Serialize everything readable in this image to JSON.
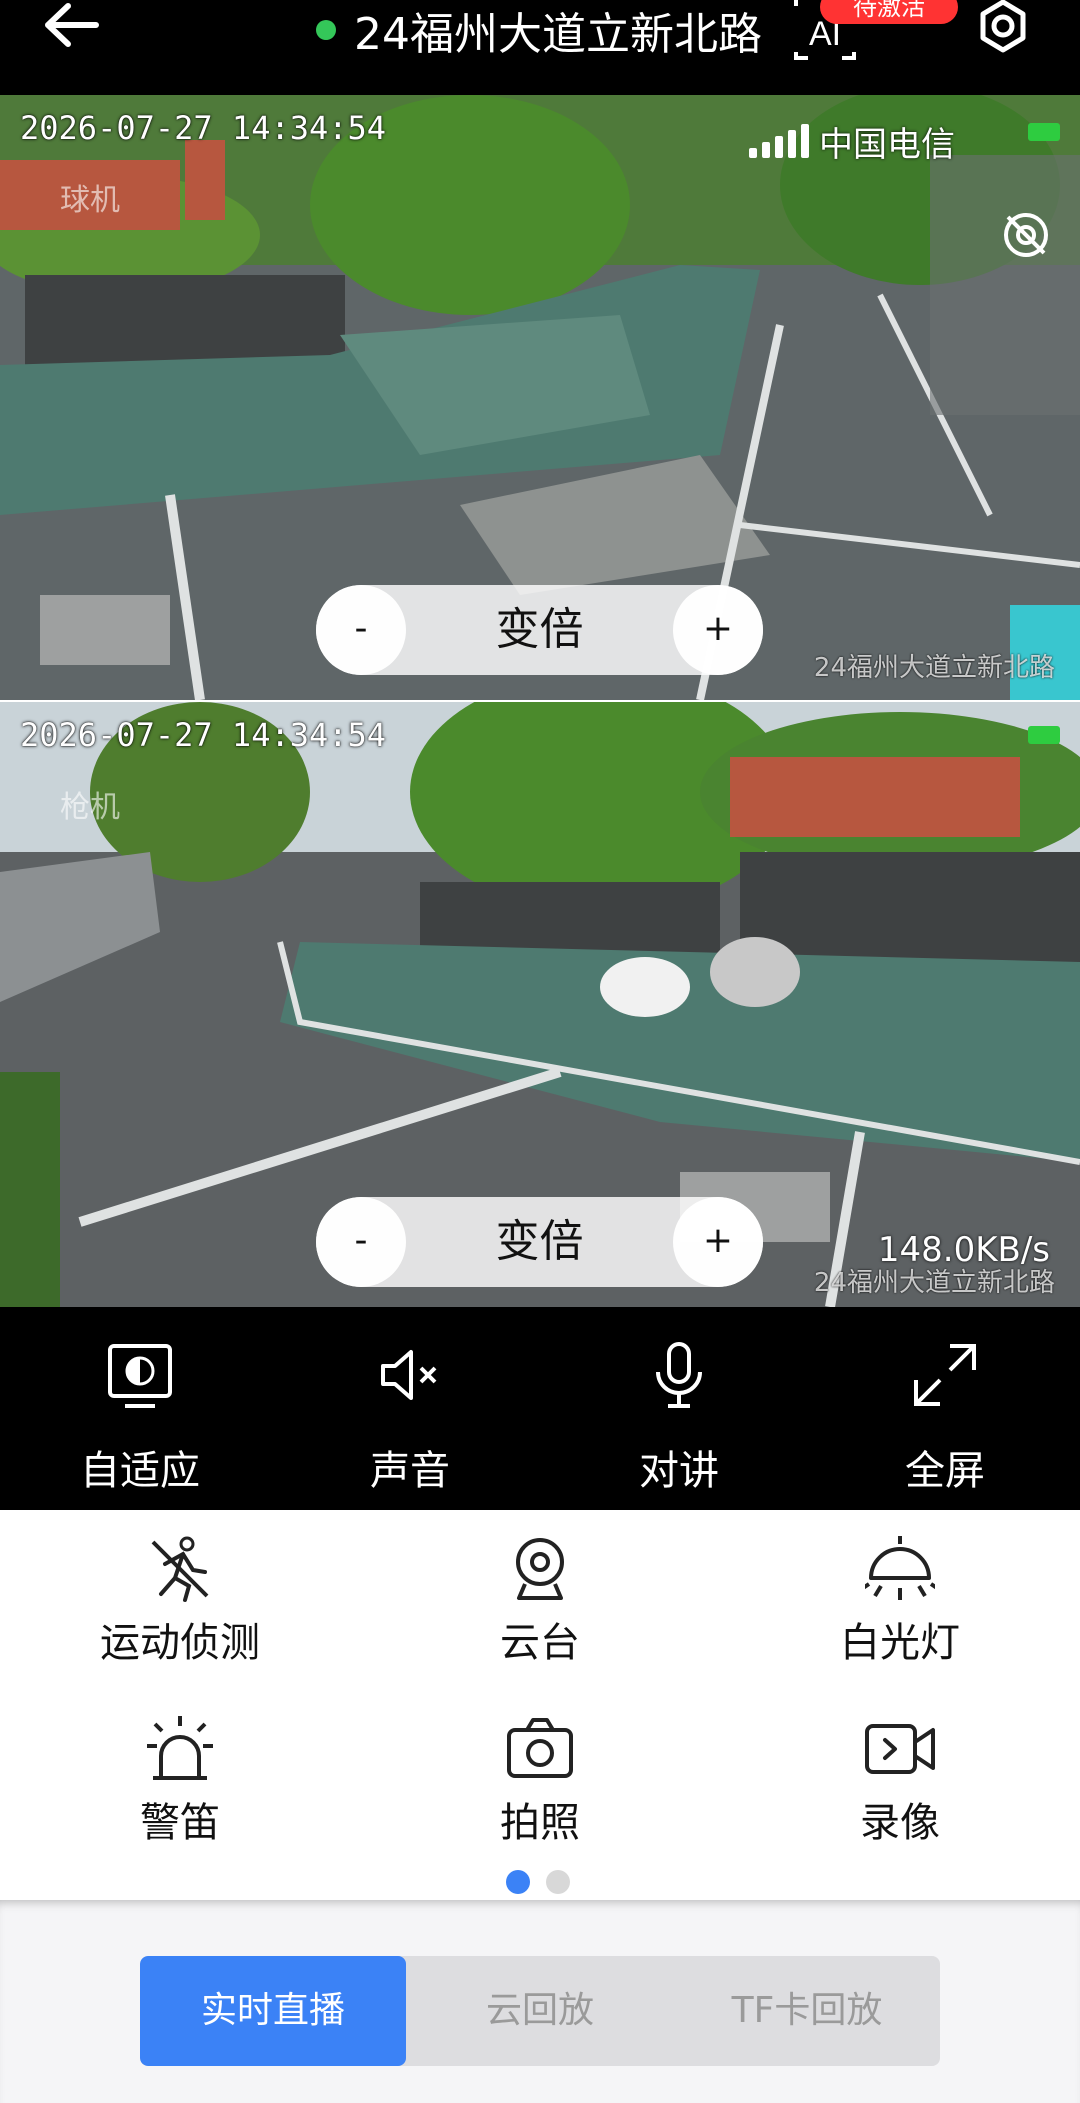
{
  "header": {
    "title": "24福州大道立新北路",
    "badge": "待激活",
    "ai_label": "AI"
  },
  "stream_top": {
    "timestamp": "2026-07-27 14:34:54",
    "camera_type": "球机",
    "osd_name": "24福州大道立新北路",
    "carrier": "中国电信",
    "zoom": {
      "minus": "-",
      "label": "变倍",
      "plus": "+"
    }
  },
  "stream_bottom": {
    "timestamp": "2026-07-27 14:34:54",
    "camera_type": "枪机",
    "osd_name": "24福州大道立新北路",
    "speed": "148.0KB/s",
    "zoom": {
      "minus": "-",
      "label": "变倍",
      "plus": "+"
    }
  },
  "controls": [
    {
      "label": "自适应",
      "icon": "adaptive-icon"
    },
    {
      "label": "声音",
      "icon": "speaker-muted-icon"
    },
    {
      "label": "对讲",
      "icon": "microphone-icon"
    },
    {
      "label": "全屏",
      "icon": "fullscreen-icon"
    }
  ],
  "functions": [
    {
      "label": "运动侦测",
      "icon": "motion-detect-off-icon"
    },
    {
      "label": "云台",
      "icon": "ptz-camera-icon"
    },
    {
      "label": "白光灯",
      "icon": "white-light-icon"
    },
    {
      "label": "警笛",
      "icon": "siren-icon"
    },
    {
      "label": "拍照",
      "icon": "camera-icon"
    },
    {
      "label": "录像",
      "icon": "video-record-icon"
    }
  ],
  "pager": {
    "current": 1,
    "total": 2
  },
  "tabs": [
    {
      "label": "实时直播",
      "active": true
    },
    {
      "label": "云回放",
      "active": false
    },
    {
      "label": "TF卡回放",
      "active": false
    }
  ],
  "colors": {
    "accent": "#3b82f6",
    "online": "#34c759",
    "badge": "#ff3333"
  }
}
